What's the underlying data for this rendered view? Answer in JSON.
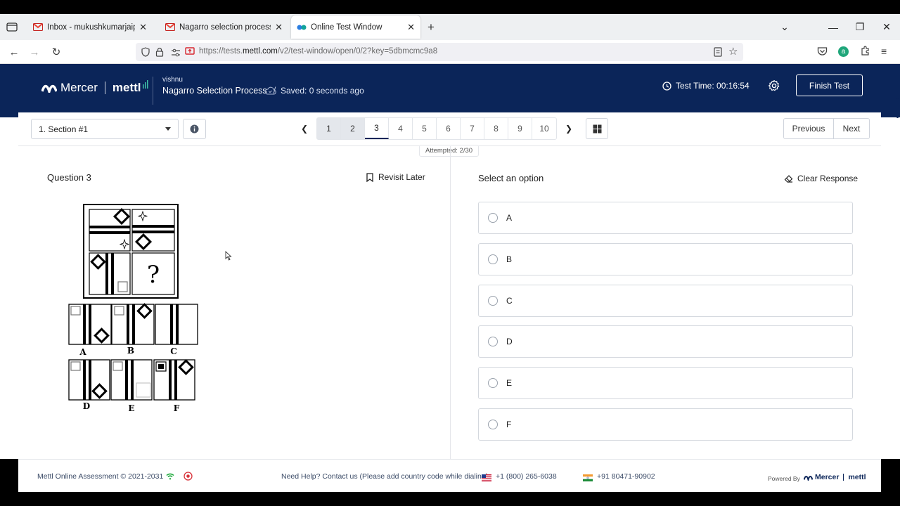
{
  "browser": {
    "tabs": [
      {
        "title": "Inbox - mukushkumarjaipur@gm",
        "icon": "gmail-icon"
      },
      {
        "title": "Nagarro selection process upda",
        "icon": "gmail-icon"
      },
      {
        "title": "Online Test Window",
        "icon": "mettl-icon"
      }
    ],
    "url_prefix": "https://tests.",
    "url_domain": "mettl.com",
    "url_path": "/v2/test-window/open/0/2?key=5dbmcmc9a8"
  },
  "header": {
    "brand_mercer": "Mercer",
    "brand_mettl": "mettl",
    "candidate_name": "vishnu",
    "process_name": "Nagarro Selection Process",
    "separator": "/",
    "saved_status": "Saved: 0 seconds ago",
    "timer_label": "Test Time: 00:16:54",
    "finish_button": "Finish Test"
  },
  "toolbar": {
    "section_value": "1. Section #1",
    "pages": [
      {
        "label": "1",
        "state": "visited"
      },
      {
        "label": "2",
        "state": "visited"
      },
      {
        "label": "3",
        "state": "current"
      },
      {
        "label": "4",
        "state": ""
      },
      {
        "label": "5",
        "state": ""
      },
      {
        "label": "6",
        "state": ""
      },
      {
        "label": "7",
        "state": ""
      },
      {
        "label": "8",
        "state": ""
      },
      {
        "label": "9",
        "state": ""
      },
      {
        "label": "10",
        "state": ""
      }
    ],
    "attempted": "Attempted: 2/30",
    "previous": "Previous",
    "next": "Next"
  },
  "question": {
    "title": "Question 3",
    "revisit": "Revisit Later",
    "figure_labels": [
      "A",
      "B",
      "C",
      "D",
      "E",
      "F"
    ],
    "question_mark": "?"
  },
  "answers": {
    "heading": "Select an option",
    "clear": "Clear Response",
    "options": [
      "A",
      "B",
      "C",
      "D",
      "E",
      "F"
    ]
  },
  "footer": {
    "copyright": "Mettl Online Assessment © 2021-2031",
    "help": "Need Help? Contact us (Please add country code while dialing)",
    "phone_us": "+1 (800) 265-6038",
    "phone_in": "+91 80471-90902",
    "powered_by": "Powered By",
    "logo_mercer": "Mercer",
    "logo_mettl": "mettl"
  },
  "colors": {
    "header_bg": "#0b2559",
    "page_bg": "#ffffff"
  }
}
